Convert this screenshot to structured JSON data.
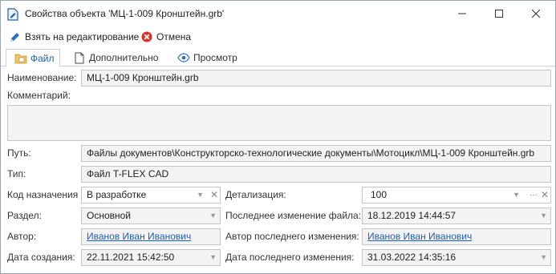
{
  "window": {
    "title": "Свойства объекта 'МЦ-1-009 Кронштейн.grb'",
    "controls": {
      "minimize": "—",
      "maximize": "☐",
      "close": "✕"
    }
  },
  "toolbar": {
    "edit_label": "Взять на редактирование",
    "cancel_label": "Отмена"
  },
  "tabs": [
    {
      "label": "Файл",
      "icon": "folder-icon",
      "active": true
    },
    {
      "label": "Дополнительно",
      "icon": "document-icon",
      "active": false
    },
    {
      "label": "Просмотр",
      "icon": "eye-icon",
      "active": false
    }
  ],
  "form": {
    "name": {
      "label": "Наименование:",
      "value": "МЦ-1-009 Кронштейн.grb"
    },
    "comment": {
      "label": "Комментарий:",
      "value": ""
    },
    "path": {
      "label": "Путь:",
      "value": "Файлы документов\\Конструкторско-технологические документы\\Мотоцикл\\МЦ-1-009 Кронштейн.grb"
    },
    "type": {
      "label": "Тип:",
      "value": "Файл T-FLEX CAD"
    },
    "purpose_code": {
      "label": "Код назначения",
      "value": "В разработке"
    },
    "detail": {
      "label": "Детализация:",
      "value": "100"
    },
    "section": {
      "label": "Раздел:",
      "value": "Основной"
    },
    "last_file_change": {
      "label": "Последнее изменение файла:",
      "value": "18.12.2019 14:44:57"
    },
    "author": {
      "label": "Автор:",
      "value": "Иванов Иван Иванович"
    },
    "last_change_author": {
      "label": "Автор последнего изменения:",
      "value": "Иванов Иван Иванович"
    },
    "created": {
      "label": "Дата создания:",
      "value": "22.11.2021 15:42:50"
    },
    "last_change_date": {
      "label": "Дата последнего изменения:",
      "value": "31.03.2022 14:35:16"
    }
  },
  "colors": {
    "accent": "#1d5fa8",
    "link": "#1f5fb8",
    "cancel": "#d9342b",
    "field_bg": "#f3f3f3",
    "border": "#c5c5c5"
  }
}
